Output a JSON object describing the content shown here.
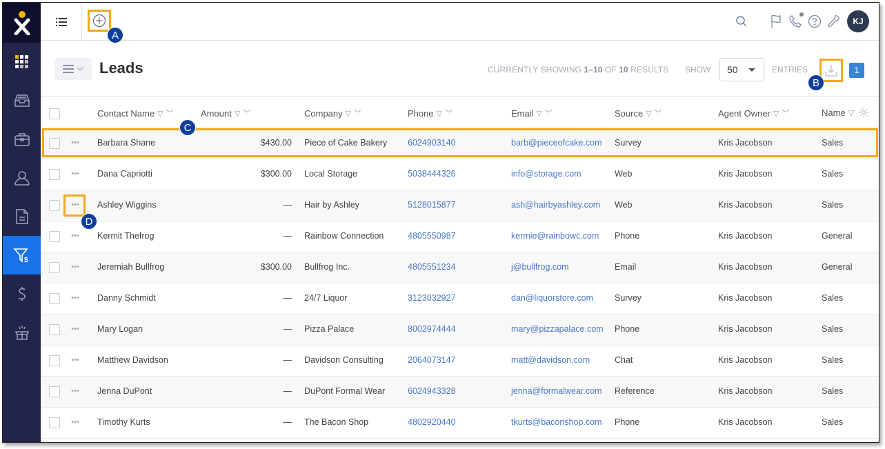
{
  "app": {
    "logo": "x",
    "accent_color": "#1a73e8",
    "highlight_color": "#f2a81d",
    "callout_color": "#0f3f9a"
  },
  "sidebar": {
    "items": [
      {
        "name": "apps-grid",
        "icon": "grid-icon",
        "active": false
      },
      {
        "name": "inbox",
        "icon": "inbox-tray-icon",
        "active": false
      },
      {
        "name": "briefcase",
        "icon": "briefcase-icon",
        "active": false
      },
      {
        "name": "contacts",
        "icon": "person-icon",
        "active": false
      },
      {
        "name": "documents",
        "icon": "document-icon",
        "active": false
      },
      {
        "name": "leads",
        "icon": "funnel-dollar-icon",
        "active": true
      },
      {
        "name": "billing",
        "icon": "dollar-icon",
        "active": false
      },
      {
        "name": "whats-new",
        "icon": "gift-box-icon",
        "active": false
      }
    ]
  },
  "topbar": {
    "user_initials": "KJ",
    "icons": [
      "search-icon",
      "flag-icon",
      "phone-icon",
      "help-icon",
      "wrench-icon"
    ]
  },
  "callouts": {
    "a": "A",
    "b": "B",
    "c": "C",
    "d": "D"
  },
  "header": {
    "title": "Leads",
    "results_prefix": "CURRENTLY SHOWING ",
    "results_range": "1–10",
    "results_of": " OF ",
    "results_total": "10",
    "results_suffix": " RESULTS",
    "show_label": "SHOW",
    "show_value": "50",
    "entries_label": "ENTRIES",
    "page_number": "1"
  },
  "table": {
    "columns": [
      "Contact Name",
      "Amount",
      "Company",
      "Phone",
      "Email",
      "Source",
      "Agent Owner",
      "Name"
    ],
    "rows": [
      {
        "contact": "Barbara Shane",
        "amount": "$430.00",
        "company": "Piece of Cake Bakery",
        "phone": "6024903140",
        "email": "barb@pieceofcake.com",
        "source": "Survey",
        "owner": "Kris Jacobson",
        "name": "Sales"
      },
      {
        "contact": "Dana Capriotti",
        "amount": "$300.00",
        "company": "Local Storage",
        "phone": "5038444326",
        "email": "info@storage.com",
        "source": "Web",
        "owner": "Kris Jacobson",
        "name": "Sales"
      },
      {
        "contact": "Ashley Wiggins",
        "amount": "—",
        "company": "Hair by Ashley",
        "phone": "5128015877",
        "email": "ash@hairbyashley.com",
        "source": "Web",
        "owner": "Kris Jacobson",
        "name": "Sales"
      },
      {
        "contact": "Kermit Thefrog",
        "amount": "—",
        "company": "Rainbow Connection",
        "phone": "4805550987",
        "email": "kermie@rainbowc.com",
        "source": "Phone",
        "owner": "Kris Jacobson",
        "name": "General"
      },
      {
        "contact": "Jeremiah Bullfrog",
        "amount": "$300.00",
        "company": "Bullfrog Inc.",
        "phone": "4805551234",
        "email": "j@bullfrog.com",
        "source": "Email",
        "owner": "Kris Jacobson",
        "name": "General"
      },
      {
        "contact": "Danny Schmidt",
        "amount": "—",
        "company": "24/7 Liquor",
        "phone": "3123032927",
        "email": "dan@liquorstore.com",
        "source": "Survey",
        "owner": "Kris Jacobson",
        "name": "Sales"
      },
      {
        "contact": "Mary Logan",
        "amount": "—",
        "company": "Pizza Palace",
        "phone": "8002974444",
        "email": "mary@pizzapalace.com",
        "source": "Phone",
        "owner": "Kris Jacobson",
        "name": "Sales"
      },
      {
        "contact": "Matthew Davidson",
        "amount": "—",
        "company": "Davidson Consulting",
        "phone": "2064073147",
        "email": "matt@davidson.com",
        "source": "Chat",
        "owner": "Kris Jacobson",
        "name": "Sales"
      },
      {
        "contact": "Jenna DuPont",
        "amount": "—",
        "company": "DuPont Formal Wear",
        "phone": "6024943328",
        "email": "jenna@formalwear.com",
        "source": "Reference",
        "owner": "Kris Jacobson",
        "name": "Sales"
      },
      {
        "contact": "Timothy Kurts",
        "amount": "—",
        "company": "The Bacon Shop",
        "phone": "4802920440",
        "email": "tkurts@baconshop.com",
        "source": "Phone",
        "owner": "Kris Jacobson",
        "name": "Sales"
      }
    ]
  }
}
